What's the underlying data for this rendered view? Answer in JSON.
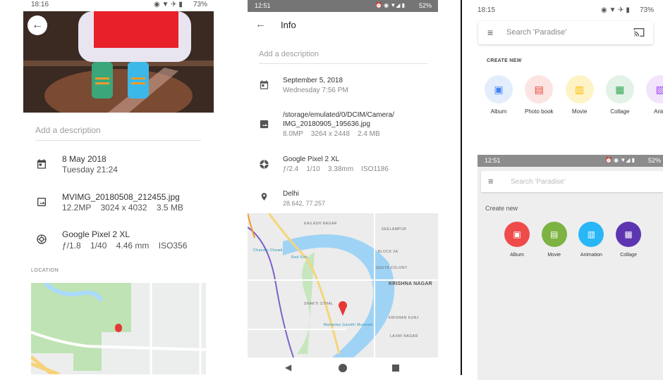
{
  "left": {
    "status": {
      "time": "18:16",
      "battery": "73%"
    },
    "description_placeholder": "Add a description",
    "date": {
      "primary": "8 May 2018",
      "secondary": "Tuesday 21:24"
    },
    "file": {
      "name": "MVIMG_20180508_212455.jpg",
      "details": "12.2MP    3024 x 4032    3.5 MB"
    },
    "camera": {
      "model": "Google Pixel 2 XL",
      "details": "ƒ/1.8    1/40    4.46 mm    ISO356"
    },
    "location_header": "LOCATION"
  },
  "middle": {
    "status": {
      "time": "12:51",
      "battery": "52%"
    },
    "title": "Info",
    "description_placeholder": "Add a description",
    "date": {
      "primary": "September 5, 2018",
      "secondary": "Wednesday 7:56 PM"
    },
    "file": {
      "path": "/storage/emulated/0/DCIM/Camera/",
      "name": "IMG_20180905_195636.jpg",
      "details": "8.0MP    3264 x 2448    2.4 MB"
    },
    "camera": {
      "model": "Google Pixel 2 XL",
      "details": "ƒ/2.4    1/10    3.38mm    ISO1186"
    },
    "location": {
      "name": "Delhi",
      "coords": "28.642, 77.257"
    },
    "map_labels": [
      "KAILASH NAGAR",
      "SEELAMPUR",
      "BLOCK 2A",
      "GEETA COLONY",
      "KRISHNA NAGAR",
      "SHAKTI STHAL",
      "KRISHAN KUNJ",
      "LAXMI NAGAR",
      "Chandni Chowk",
      "Red Fort",
      "Mahatma Gandhi Museum"
    ]
  },
  "right_top": {
    "status": {
      "time": "18:15",
      "battery": "73%"
    },
    "search_placeholder": "Search 'Paradise'",
    "section": "CREATE NEW",
    "items": [
      {
        "label": "Album",
        "bg": "#e3edfb",
        "fg": "#4285f4"
      },
      {
        "label": "Photo book",
        "bg": "#fbe4e2",
        "fg": "#ea4335"
      },
      {
        "label": "Movie",
        "bg": "#fdf3c6",
        "fg": "#fbbc05"
      },
      {
        "label": "Collage",
        "bg": "#e3f2e7",
        "fg": "#34a853"
      },
      {
        "label": "Anim",
        "bg": "#f1e4fb",
        "fg": "#a142f4"
      }
    ]
  },
  "right_bottom": {
    "status": {
      "time": "12:51",
      "battery": "52%"
    },
    "search_placeholder": "Search 'Paradise'",
    "section": "Create new",
    "items": [
      {
        "label": "Album",
        "bg": "#ef4b4b"
      },
      {
        "label": "Movie",
        "bg": "#7cb342"
      },
      {
        "label": "Animation",
        "bg": "#29b6f6"
      },
      {
        "label": "Collage",
        "bg": "#5e35b1"
      }
    ]
  }
}
